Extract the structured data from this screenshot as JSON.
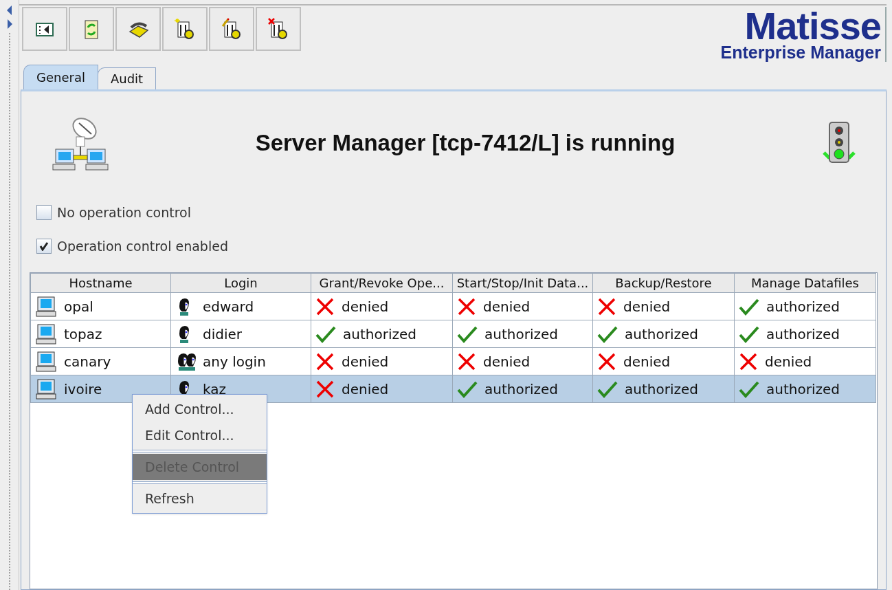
{
  "toolbar": [
    {
      "kind": "panel"
    },
    {
      "kind": "refresh"
    },
    {
      "kind": "phone"
    },
    {
      "kind": "new"
    },
    {
      "kind": "edit"
    },
    {
      "kind": "delete"
    }
  ],
  "logo": {
    "title": "Matisse",
    "subtitle": "Enterprise Manager"
  },
  "tabs": [
    {
      "label": "General",
      "selected": true
    },
    {
      "label": "Audit",
      "selected": false
    }
  ],
  "status_title": "Server Manager [tcp-7412/L] is running",
  "options": [
    {
      "label": "No operation control",
      "checked": false
    },
    {
      "label": "Operation control enabled",
      "checked": true
    }
  ],
  "table": {
    "columns": [
      "Hostname",
      "Login",
      "Grant/Revoke Ope...",
      "Start/Stop/Init Data...",
      "Backup/Restore",
      "Manage Datafiles"
    ],
    "rows": [
      {
        "selected": false,
        "cells": [
          {
            "text": "opal"
          },
          {
            "text": "edward",
            "kind": "user"
          },
          {
            "text": "denied",
            "granted": false
          },
          {
            "text": "denied",
            "granted": false
          },
          {
            "text": "denied",
            "granted": false
          },
          {
            "text": "authorized",
            "granted": true
          }
        ]
      },
      {
        "selected": false,
        "cells": [
          {
            "text": "topaz"
          },
          {
            "text": "didier",
            "kind": "user"
          },
          {
            "text": "authorized",
            "granted": true
          },
          {
            "text": "authorized",
            "granted": true
          },
          {
            "text": "authorized",
            "granted": true
          },
          {
            "text": "authorized",
            "granted": true
          }
        ]
      },
      {
        "selected": false,
        "cells": [
          {
            "text": "canary"
          },
          {
            "text": "any login",
            "kind": "group"
          },
          {
            "text": "denied",
            "granted": false
          },
          {
            "text": "denied",
            "granted": false
          },
          {
            "text": "denied",
            "granted": false
          },
          {
            "text": "denied",
            "granted": false
          }
        ]
      },
      {
        "selected": true,
        "cells": [
          {
            "text": "ivoire"
          },
          {
            "text": "kaz",
            "kind": "user"
          },
          {
            "text": "denied",
            "granted": false
          },
          {
            "text": "authorized",
            "granted": true
          },
          {
            "text": "authorized",
            "granted": true
          },
          {
            "text": "authorized",
            "granted": true
          }
        ]
      }
    ]
  },
  "context_menu": [
    {
      "label": "Add Control...",
      "selected": false
    },
    {
      "label": "Edit Control...",
      "selected": false
    },
    {
      "label": "Delete Control",
      "selected": true
    },
    {
      "label": "Refresh",
      "selected": false
    }
  ]
}
